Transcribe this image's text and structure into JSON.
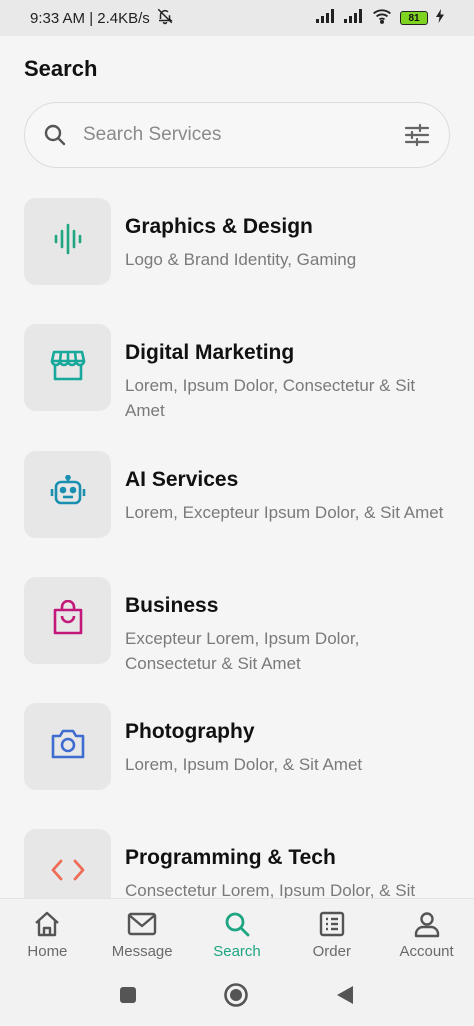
{
  "status_bar": {
    "time_speed": "9:33 AM | 2.4KB/s",
    "battery": "81"
  },
  "page": {
    "title": "Search"
  },
  "search": {
    "placeholder": "Search Services"
  },
  "categories": [
    {
      "title": "Graphics & Design",
      "subtitle": "Logo & Brand Identity, Gaming",
      "icon": "soundwave-icon",
      "color": "#1ea582"
    },
    {
      "title": "Digital Marketing",
      "subtitle": "Lorem, Ipsum Dolor, Consectetur & Sit Amet",
      "icon": "storefront-icon",
      "color": "#16a89a"
    },
    {
      "title": "AI Services",
      "subtitle": "Lorem, Excepteur Ipsum Dolor, & Sit Amet",
      "icon": "robot-icon",
      "color": "#1a8fb0"
    },
    {
      "title": "Business",
      "subtitle": "Excepteur Lorem, Ipsum Dolor, Consectetur & Sit Amet",
      "icon": "shopping-bag-icon",
      "color": "#c2187a"
    },
    {
      "title": "Photography",
      "subtitle": "Lorem, Ipsum Dolor, & Sit Amet",
      "icon": "camera-icon",
      "color": "#3f6cd0"
    },
    {
      "title": "Programming & Tech",
      "subtitle": "Consectetur Lorem, Ipsum Dolor, & Sit Amet",
      "icon": "code-icon",
      "color": "#ee6b55"
    }
  ],
  "bottom_nav": [
    {
      "label": "Home",
      "icon": "home-icon"
    },
    {
      "label": "Message",
      "icon": "mail-icon"
    },
    {
      "label": "Search",
      "icon": "search-icon",
      "active": true
    },
    {
      "label": "Order",
      "icon": "order-list-icon"
    },
    {
      "label": "Account",
      "icon": "user-icon"
    }
  ],
  "colors": {
    "accent": "#1ea582",
    "inactive": "#6a6a6a"
  }
}
